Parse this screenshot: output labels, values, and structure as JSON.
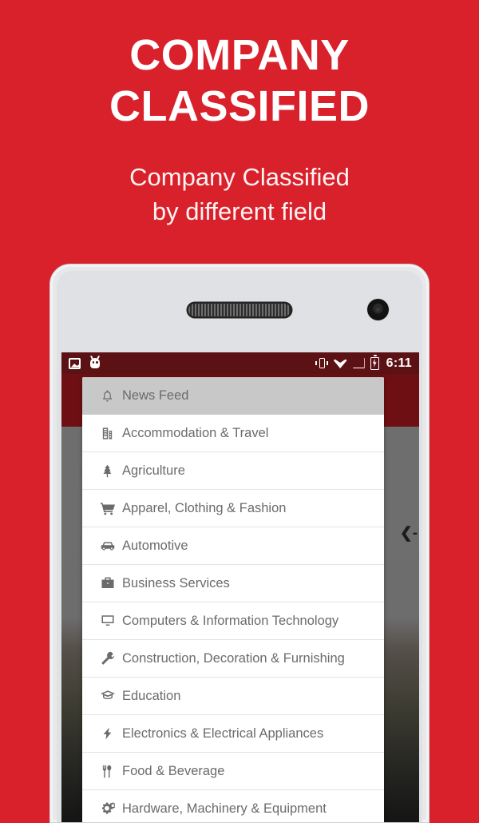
{
  "promo": {
    "title_line1": "COMPANY",
    "title_line2": "CLASSIFIED",
    "subtitle_line1": "Company Classified",
    "subtitle_line2": "by different field",
    "background_color": "#d9212c",
    "text_color": "#ffffff"
  },
  "status_bar": {
    "time": "6:11",
    "background_color": "#5c1215",
    "left_icons": [
      "photo-icon",
      "android-droid-icon"
    ],
    "right_icons": [
      "vibrate-icon",
      "wifi-icon",
      "signal-no-service-icon",
      "battery-charging-icon"
    ]
  },
  "app": {
    "appbar_color": "#6e1013",
    "drawer_handle_label": "❮-",
    "drawer_background": "#ffffff",
    "active_row_color": "#c8c8c8",
    "row_text_color": "#6b6b6b"
  },
  "drawer": {
    "items": [
      {
        "label": "News Feed",
        "icon": "bell-icon",
        "active": true
      },
      {
        "label": "Accommodation & Travel",
        "icon": "building-icon",
        "active": false
      },
      {
        "label": "Agriculture",
        "icon": "tree-icon",
        "active": false
      },
      {
        "label": "Apparel, Clothing & Fashion",
        "icon": "shopping-cart-icon",
        "active": false
      },
      {
        "label": "Automotive",
        "icon": "car-icon",
        "active": false
      },
      {
        "label": "Business Services",
        "icon": "briefcase-icon",
        "active": false
      },
      {
        "label": "Computers & Information Technology",
        "icon": "desktop-monitor-icon",
        "active": false
      },
      {
        "label": "Construction, Decoration & Furnishing",
        "icon": "wrench-icon",
        "active": false
      },
      {
        "label": "Education",
        "icon": "graduation-cap-icon",
        "active": false
      },
      {
        "label": "Electronics & Electrical Appliances",
        "icon": "lightning-bolt-icon",
        "active": false
      },
      {
        "label": "Food & Beverage",
        "icon": "cutlery-icon",
        "active": false
      },
      {
        "label": "Hardware, Machinery & Equipment",
        "icon": "cogs-icon",
        "active": false
      }
    ]
  }
}
